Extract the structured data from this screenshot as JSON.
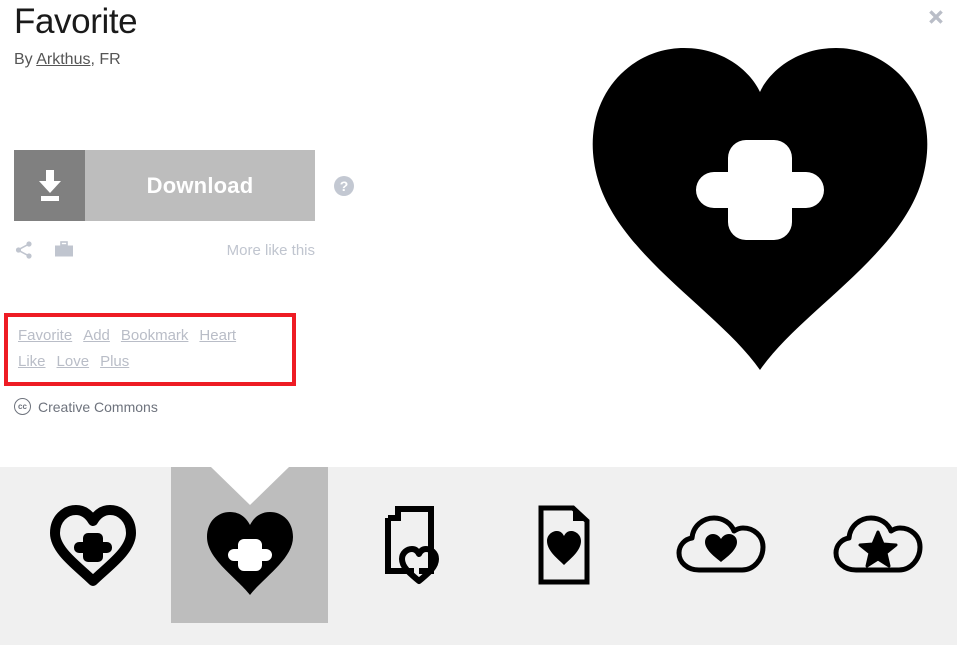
{
  "header": {
    "title": "Favorite",
    "byline_prefix": "By ",
    "author": "Arkthus",
    "byline_suffix": ", FR",
    "close_icon": "close-icon"
  },
  "actions": {
    "download_label": "Download",
    "download_icon": "download-arrow-icon",
    "help_icon": "?",
    "share_icon": "share-icon",
    "briefcase_icon": "briefcase-icon",
    "more_like_this_label": "More like this"
  },
  "tags": {
    "highlight_color": "#ee1c24",
    "items": [
      {
        "label": "Favorite"
      },
      {
        "label": "Add"
      },
      {
        "label": "Bookmark"
      },
      {
        "label": "Heart"
      },
      {
        "label": "Like"
      },
      {
        "label": "Love"
      },
      {
        "label": "Plus"
      }
    ]
  },
  "license": {
    "badge": "cc",
    "label": "Creative Commons"
  },
  "preview": {
    "icon_name": "heart-with-plus-filled-icon",
    "color": "#000000"
  },
  "thumbnails": {
    "strip_background": "#f0f0f0",
    "selected_background": "#bdbdbd",
    "items": [
      {
        "icon_name": "heart-outline-with-plus-icon",
        "selected": false
      },
      {
        "icon_name": "heart-filled-with-plus-icon",
        "selected": true
      },
      {
        "icon_name": "document-with-heart-outline-icon",
        "selected": false
      },
      {
        "icon_name": "page-with-heart-filled-icon",
        "selected": false
      },
      {
        "icon_name": "cloud-with-heart-icon",
        "selected": false
      },
      {
        "icon_name": "cloud-with-star-icon",
        "selected": false
      }
    ]
  }
}
